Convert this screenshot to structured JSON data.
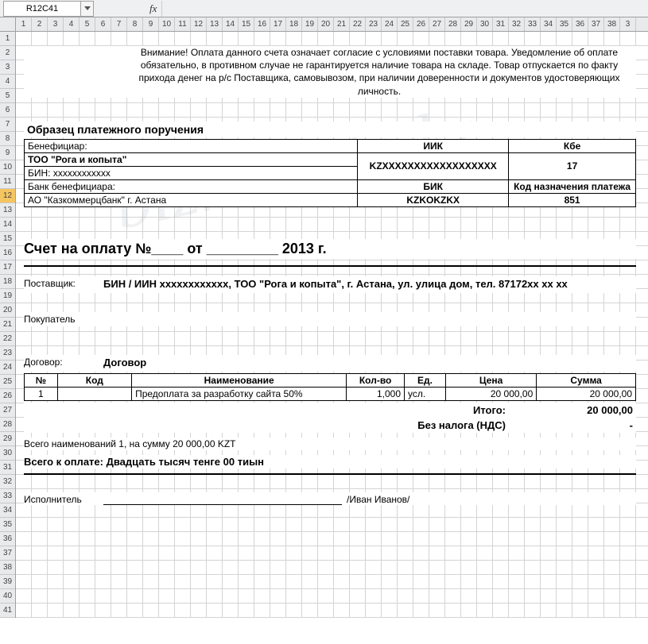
{
  "formula": {
    "cell_ref": "R12C41",
    "fx_label": "fx",
    "value": ""
  },
  "columns": [
    "1",
    "2",
    "3",
    "4",
    "5",
    "6",
    "7",
    "8",
    "9",
    "10",
    "11",
    "12",
    "13",
    "14",
    "15",
    "16",
    "17",
    "18",
    "19",
    "20",
    "21",
    "22",
    "23",
    "24",
    "25",
    "26",
    "27",
    "28",
    "29",
    "30",
    "31",
    "32",
    "33",
    "34",
    "35",
    "36",
    "37",
    "38",
    "3"
  ],
  "rows": [
    "1",
    "2",
    "3",
    "4",
    "5",
    "6",
    "7",
    "8",
    "9",
    "10",
    "11",
    "12",
    "13",
    "14",
    "15",
    "16",
    "17",
    "18",
    "19",
    "20",
    "21",
    "22",
    "23",
    "24",
    "25",
    "26",
    "27",
    "28",
    "29",
    "30",
    "31",
    "32",
    "33",
    "34",
    "35",
    "36",
    "37",
    "38",
    "39",
    "40",
    "41"
  ],
  "disclaimer": "Внимание! Оплата данного счета означает согласие с условиями поставки товара. Уведомление об оплате\nобязательно, в противном случае не гарантируется наличие товара на складе. Товар отпускается по факту  прихода денег на р/с Поставщика, самовывозом, при наличии доверенности и документов удостоверяющих личность.",
  "sample_label": "Образец платежного поручения",
  "bank": {
    "beneficiary_label": "Бенефициар:",
    "iik_label": "ИИК",
    "kbe_label": "Кбе",
    "company": "ТОО \"Рога и копыта\"",
    "iik": "KZXXXXXXXXXXXXXXXXXX",
    "bin_line": "БИН: xxxxxxxxxxxx",
    "kbe": "17",
    "bank_label": "Банк бенефициара:",
    "bik_label": "БИК",
    "knp_label": "Код назначения платежа",
    "bank_name": "АО \"Казкоммерцбанк\" г. Астана",
    "bik": "KZKOKZKX",
    "knp": "851"
  },
  "invoice_title": "Счет на оплату №____  от _________ 2013 г.",
  "supplier": {
    "label": "Поставщик:",
    "value": "БИН / ИИН xxxxxxxxxxxx, ТОО \"Рога и копыта\", г. Астана, ул. улица дом, тел. 87172xx xx xx"
  },
  "buyer": {
    "label": "Покупатель",
    "value": ""
  },
  "contract": {
    "label": "Договор:",
    "value": "Договор"
  },
  "items": {
    "headers": {
      "no": "№",
      "code": "Код",
      "name": "Наименование",
      "qty": "Кол-во",
      "unit": "Ед.",
      "price": "Цена",
      "sum": "Сумма"
    },
    "rows": [
      {
        "no": "1",
        "code": "",
        "name": "Предоплата за разработку сайта 50%",
        "qty": "1,000",
        "unit": "усл.",
        "price": "20 000,00",
        "sum": "20 000,00"
      }
    ]
  },
  "totals": {
    "itogo_label": "Итого:",
    "itogo": "20 000,00",
    "vat_label": "Без налога (НДС)",
    "vat": "-"
  },
  "summary1": "Всего наименований 1, на сумму 20 000,00 KZT",
  "summary2": "Всего к оплате: Двадцать тысяч тенге 00 тиын",
  "sig": {
    "label": "Исполнитель",
    "name": "/Иван Иванов/"
  },
  "watermark": "biznesinfo.kz"
}
